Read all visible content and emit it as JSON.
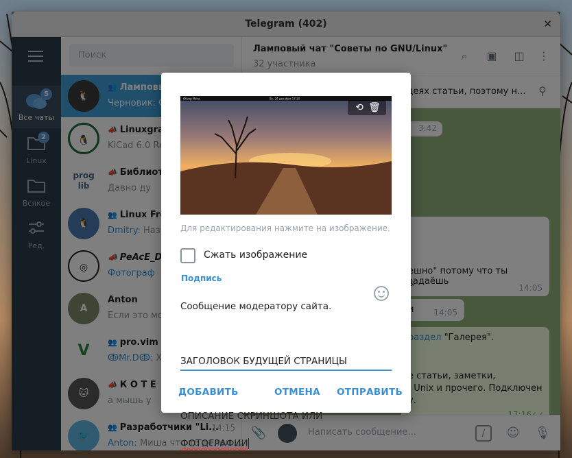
{
  "window": {
    "title": "Telegram (402)"
  },
  "folders": [
    {
      "label": "Все чаты",
      "badge": "5"
    },
    {
      "label": "Linux",
      "badge": "2"
    },
    {
      "label": "Всякое"
    },
    {
      "label": "Ред."
    }
  ],
  "search": {
    "placeholder": "Поиск"
  },
  "chats": [
    {
      "name": "Ламповый",
      "preview_sender": "Черновик:",
      "preview": " С"
    },
    {
      "name": "Linuxgram",
      "preview": "KiCad 6.0 Rel"
    },
    {
      "name": "Библиот",
      "preview": "Давно ду"
    },
    {
      "name": "Linux Fro",
      "preview_sender": "Dmitry:",
      "preview": " Назв"
    },
    {
      "name": "PeAcE_D",
      "preview": "Фотограф"
    },
    {
      "name": "Anton",
      "preview": "Если это мож"
    },
    {
      "name": "pro.vim",
      "preview_sender": "ↂMr.Dↂ:",
      "preview": " Хо"
    },
    {
      "name": "К О Т Е",
      "preview": "а мышь у"
    },
    {
      "name": "Разработчики \"Li...",
      "time": "14:15",
      "preview_sender": "Anton:",
      "preview": " Миша что то делал ..."
    }
  ],
  "header": {
    "title": "Ламповый чат \"Советы по GNU/Linux\"",
    "subtitle": "32 участника"
  },
  "pinned": {
    "text": "идеях статьи, поэтому н..."
  },
  "messages": [
    {
      "text": "ешно\" потому что ты задаёшь",
      "text2": "ы",
      "time": "14:05"
    },
    {
      "text": "и",
      "time": "14:05"
    },
    {
      "link": "раздел",
      "text": " \"Галерея\".",
      "text2": "е статьи, заметки,",
      "text3": ", Unix и прочего. Подключен",
      "text4": "у.",
      "time": "17:16"
    }
  ],
  "msg_time_top": "3:42",
  "composer": {
    "placeholder": "Написать сообщение..."
  },
  "dialog": {
    "hint": "Для редактирования нажмите на изображение.",
    "compress_label": "Сжать изображение",
    "caption_label": "Подпись",
    "caption_lines": [
      "Сообщение модератору сайта.",
      "",
      "ЗАГОЛОВОК БУДУЩЕЙ СТРАНИЦЫ",
      "",
      "ОПИСАНИЕ СКРИНШОТА ИЛИ"
    ],
    "caption_last_misspelled": "ФОТОГРАФИИ",
    "add_button": "ДОБАВИТЬ",
    "cancel_button": "ОТМЕНА",
    "send_button": "ОТПРАВИТЬ",
    "photo_topbar_left": "Обзор   Мега",
    "photo_topbar_center": "Вс, 24 декабря 17:20"
  },
  "colors": {
    "accent": "#3b8fd0",
    "active_chat": "#419fd9",
    "sidebar": "#2b3a4a",
    "chat_bg": "#8fb17a"
  }
}
